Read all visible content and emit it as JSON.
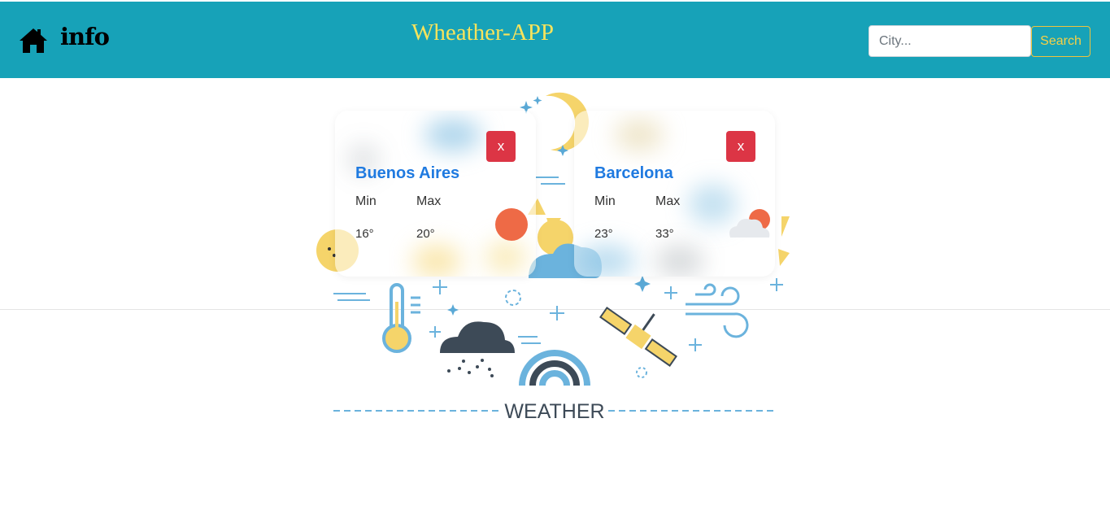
{
  "nav": {
    "home_icon": "home-icon",
    "info_label": "info",
    "title": "Wheather-APP",
    "search": {
      "placeholder": "City...",
      "value": "",
      "button_label": "Search"
    }
  },
  "background": {
    "banner_text": "WEATHER"
  },
  "cards": [
    {
      "city": "Buenos Aires",
      "min_label": "Min",
      "max_label": "Max",
      "min": "16°",
      "max": "20°",
      "close_label": "x",
      "icon": "sun-icon"
    },
    {
      "city": "Barcelona",
      "min_label": "Min",
      "max_label": "Max",
      "min": "23°",
      "max": "33°",
      "close_label": "x",
      "icon": "partly-cloudy-icon"
    }
  ],
  "colors": {
    "navbar": "#17a2b8",
    "title": "#f7e35c",
    "danger": "#dc3545",
    "city": "#1f7ae0"
  }
}
